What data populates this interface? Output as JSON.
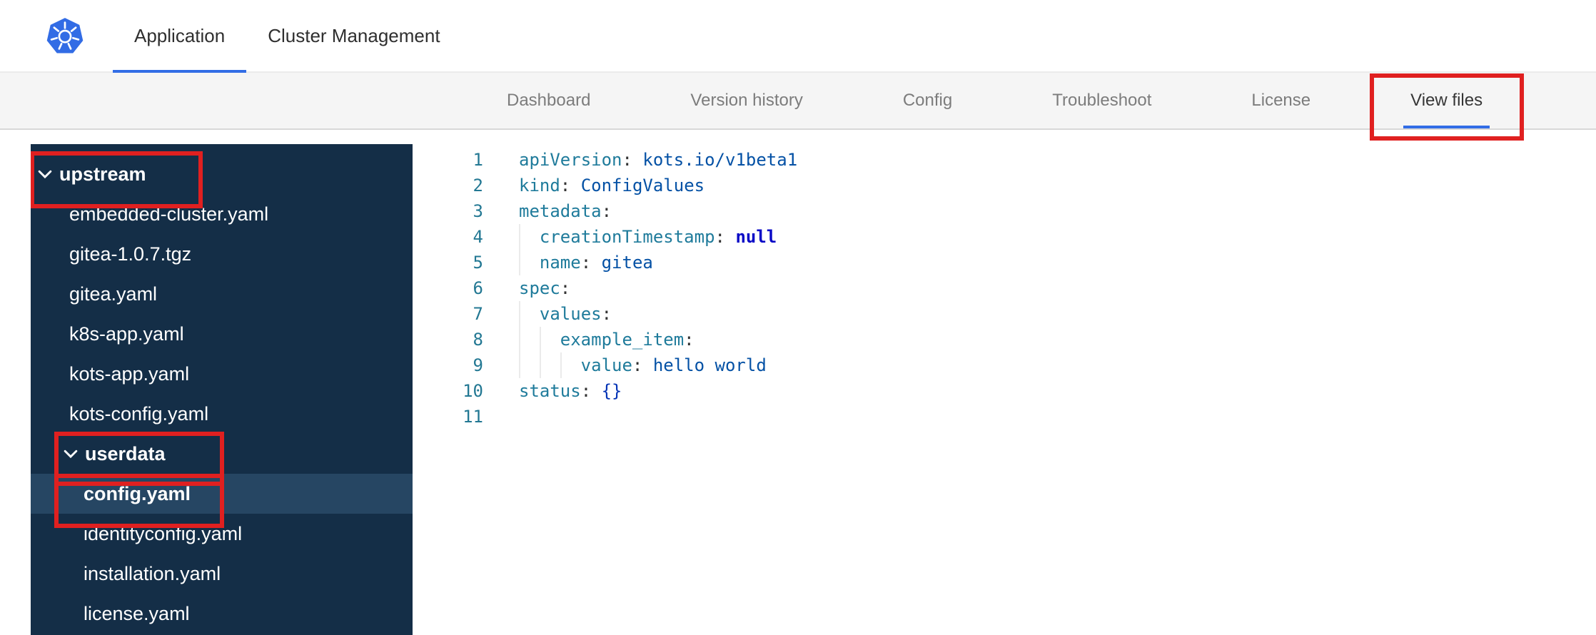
{
  "colors": {
    "accent-blue": "#326de6",
    "annotation-red": "#e02020",
    "subnav-bg": "#f5f5f5",
    "sidebar-bg": "#142e47",
    "sidebar-selected-bg": "#264663",
    "code-key": "#1f7b9b",
    "code-value": "#0451a5",
    "code-keyword": "#0909c6",
    "code-bracket": "#0433b5",
    "code-punct": "#333333",
    "line-number": "#237893",
    "tab-inactive": "#7c7c7c",
    "tab-active": "#363636"
  },
  "header": {
    "logo": "kubernetes-logo",
    "tabs": [
      {
        "label": "Application",
        "active": true
      },
      {
        "label": "Cluster Management",
        "active": false
      }
    ]
  },
  "subnav": {
    "tabs": [
      {
        "label": "Dashboard",
        "active": false,
        "annotated": false
      },
      {
        "label": "Version history",
        "active": false,
        "annotated": false
      },
      {
        "label": "Config",
        "active": false,
        "annotated": false
      },
      {
        "label": "Troubleshoot",
        "active": false,
        "annotated": false
      },
      {
        "label": "License",
        "active": false,
        "annotated": false
      },
      {
        "label": "View files",
        "active": true,
        "annotated": true
      }
    ]
  },
  "file_tree": {
    "items": [
      {
        "type": "folder",
        "label": "upstream",
        "depth": 0,
        "expanded": true,
        "annotated": true,
        "selected": false
      },
      {
        "type": "file",
        "label": "embedded-cluster.yaml",
        "depth": 1,
        "annotated": false,
        "selected": false
      },
      {
        "type": "file",
        "label": "gitea-1.0.7.tgz",
        "depth": 1,
        "annotated": false,
        "selected": false
      },
      {
        "type": "file",
        "label": "gitea.yaml",
        "depth": 1,
        "annotated": false,
        "selected": false
      },
      {
        "type": "file",
        "label": "k8s-app.yaml",
        "depth": 1,
        "annotated": false,
        "selected": false
      },
      {
        "type": "file",
        "label": "kots-app.yaml",
        "depth": 1,
        "annotated": false,
        "selected": false
      },
      {
        "type": "file",
        "label": "kots-config.yaml",
        "depth": 1,
        "annotated": false,
        "selected": false
      },
      {
        "type": "folder",
        "label": "userdata",
        "depth": 1,
        "expanded": true,
        "annotated": true,
        "selected": false
      },
      {
        "type": "file",
        "label": "config.yaml",
        "depth": 2,
        "annotated": true,
        "selected": true
      },
      {
        "type": "file",
        "label": "identityconfig.yaml",
        "depth": 2,
        "annotated": false,
        "selected": false
      },
      {
        "type": "file",
        "label": "installation.yaml",
        "depth": 2,
        "annotated": false,
        "selected": false
      },
      {
        "type": "file",
        "label": "license.yaml",
        "depth": 2,
        "annotated": false,
        "selected": false
      }
    ]
  },
  "editor": {
    "language": "yaml",
    "lines": [
      {
        "number": 1,
        "indent": 0,
        "tokens": [
          {
            "type": "key",
            "text": "apiVersion"
          },
          {
            "type": "punct",
            "text": ": "
          },
          {
            "type": "value",
            "text": "kots.io/v1beta1"
          }
        ]
      },
      {
        "number": 2,
        "indent": 0,
        "tokens": [
          {
            "type": "key",
            "text": "kind"
          },
          {
            "type": "punct",
            "text": ": "
          },
          {
            "type": "value",
            "text": "ConfigValues"
          }
        ]
      },
      {
        "number": 3,
        "indent": 0,
        "tokens": [
          {
            "type": "key",
            "text": "metadata"
          },
          {
            "type": "punct",
            "text": ":"
          }
        ]
      },
      {
        "number": 4,
        "indent": 2,
        "tokens": [
          {
            "type": "key",
            "text": "creationTimestamp"
          },
          {
            "type": "punct",
            "text": ": "
          },
          {
            "type": "keyword",
            "text": "null"
          }
        ]
      },
      {
        "number": 5,
        "indent": 2,
        "tokens": [
          {
            "type": "key",
            "text": "name"
          },
          {
            "type": "punct",
            "text": ": "
          },
          {
            "type": "value",
            "text": "gitea"
          }
        ]
      },
      {
        "number": 6,
        "indent": 0,
        "tokens": [
          {
            "type": "key",
            "text": "spec"
          },
          {
            "type": "punct",
            "text": ":"
          }
        ]
      },
      {
        "number": 7,
        "indent": 2,
        "tokens": [
          {
            "type": "key",
            "text": "values"
          },
          {
            "type": "punct",
            "text": ":"
          }
        ]
      },
      {
        "number": 8,
        "indent": 4,
        "tokens": [
          {
            "type": "key",
            "text": "example_item"
          },
          {
            "type": "punct",
            "text": ":"
          }
        ]
      },
      {
        "number": 9,
        "indent": 6,
        "tokens": [
          {
            "type": "key",
            "text": "value"
          },
          {
            "type": "punct",
            "text": ": "
          },
          {
            "type": "value",
            "text": "hello world"
          }
        ]
      },
      {
        "number": 10,
        "indent": 0,
        "tokens": [
          {
            "type": "key",
            "text": "status"
          },
          {
            "type": "punct",
            "text": ": "
          },
          {
            "type": "bracket",
            "text": "{}"
          }
        ]
      },
      {
        "number": 11,
        "indent": 0,
        "tokens": []
      }
    ]
  }
}
